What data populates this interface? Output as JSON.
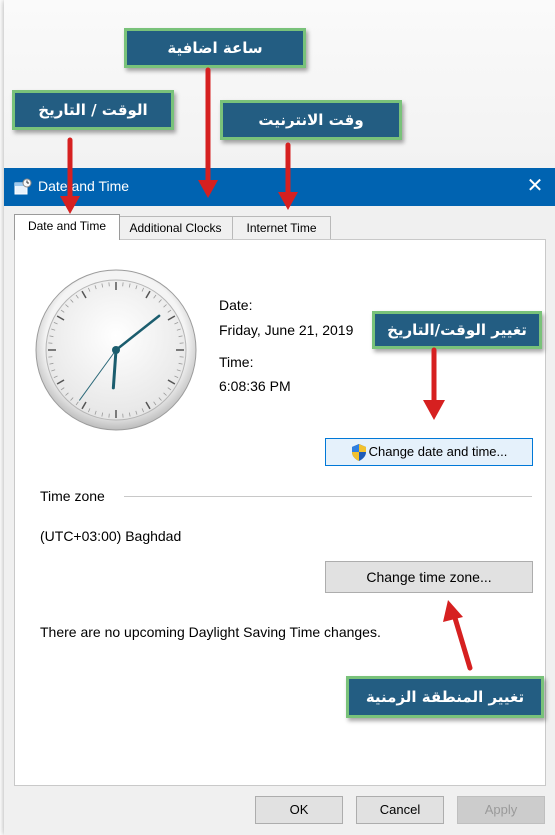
{
  "window": {
    "title": "Date and Time",
    "close_symbol": "✕"
  },
  "tabs": [
    {
      "label": "Date and Time",
      "active": true
    },
    {
      "label": "Additional Clocks",
      "active": false
    },
    {
      "label": "Internet Time",
      "active": false
    }
  ],
  "main": {
    "date_label": "Date:",
    "date_value": "Friday, June 21, 2019",
    "time_label": "Time:",
    "time_value": "6:08:36 PM",
    "change_datetime_button": "Change date and time...",
    "timezone_header": "Time zone",
    "timezone_value": "(UTC+03:00) Baghdad",
    "change_timezone_button": "Change time zone...",
    "dst_message": "There are no upcoming Daylight Saving Time changes."
  },
  "clock": {
    "hour": 6,
    "minute": 8,
    "second": 36
  },
  "footer": {
    "ok_label": "OK",
    "cancel_label": "Cancel",
    "apply_label": "Apply"
  },
  "annotations": {
    "extra_clock": "ساعة اضافية",
    "date_time": "الوقت / التاريخ",
    "internet_time": "وقت الانترنيت",
    "change_date_time": "تغيير الوقت/التاريخ",
    "change_timezone": "تغيير المنطقة الزمنية"
  },
  "colors": {
    "titlebar": "#0063b1",
    "callout_bg": "#235d82",
    "callout_border": "#79c27a",
    "arrow": "#d62020"
  },
  "icons": {
    "title": "settings-clock-icon",
    "uac": "uac-shield-icon",
    "close": "close-icon"
  }
}
